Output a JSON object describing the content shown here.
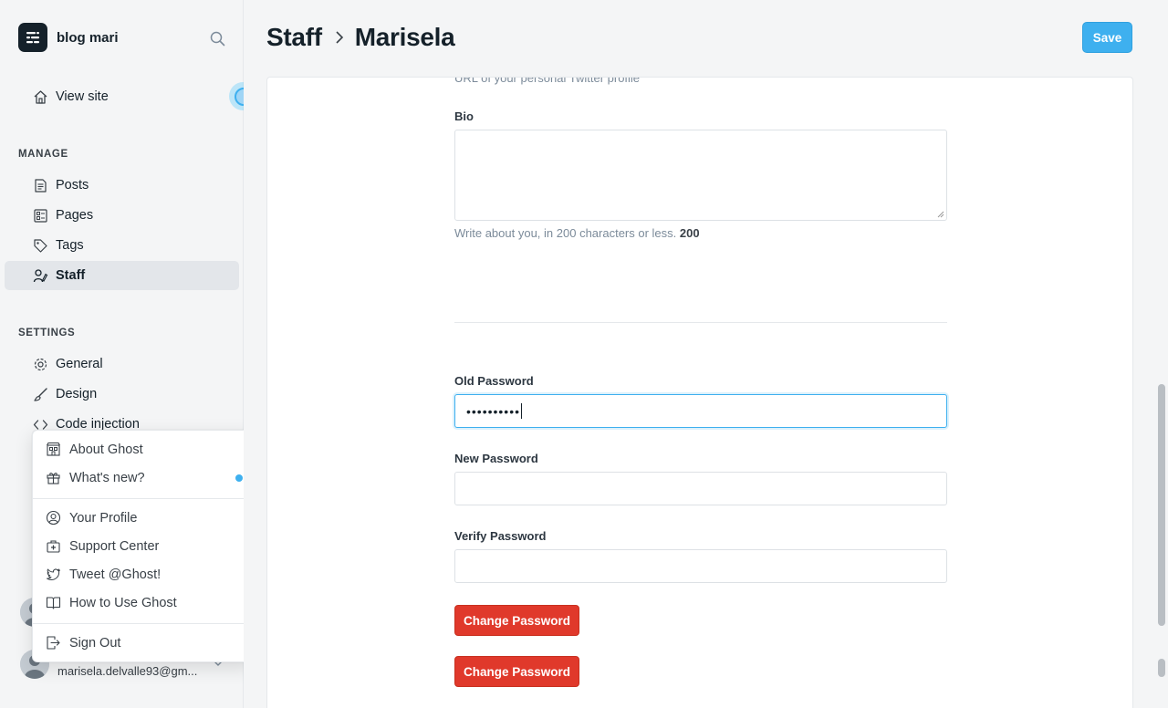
{
  "sidebar": {
    "brand_name": "blog mari",
    "view_site": "View site",
    "manage_label": "MANAGE",
    "settings_label": "SETTINGS",
    "manage_items": [
      {
        "label": "Posts",
        "icon": "posts-icon"
      },
      {
        "label": "Pages",
        "icon": "pages-icon"
      },
      {
        "label": "Tags",
        "icon": "tag-icon"
      },
      {
        "label": "Staff",
        "icon": "staff-icon",
        "active": true
      }
    ],
    "settings_items": [
      {
        "label": "General",
        "icon": "gear-icon"
      },
      {
        "label": "Design",
        "icon": "brush-icon"
      },
      {
        "label": "Code injection",
        "icon": "code-icon"
      }
    ],
    "user_email": "marisela.delvalle93@gm..."
  },
  "user_menu": {
    "items": [
      {
        "label": "About Ghost",
        "icon": "building-icon"
      },
      {
        "label": "What's new?",
        "icon": "gift-icon",
        "has_dot": true
      },
      {
        "label": "Your Profile",
        "icon": "user-circle-icon"
      },
      {
        "label": "Support Center",
        "icon": "support-icon"
      },
      {
        "label": "Tweet @Ghost!",
        "icon": "twitter-icon"
      },
      {
        "label": "How to Use Ghost",
        "icon": "book-icon"
      },
      {
        "label": "Sign Out",
        "icon": "sign-out-icon"
      }
    ]
  },
  "header": {
    "crumb_parent": "Staff",
    "crumb_current": "Marisela",
    "save_label": "Save"
  },
  "form": {
    "twitter_hint": "URL of your personal Twitter profile",
    "bio_label": "Bio",
    "bio_value": "",
    "bio_hint": "Write about you, in 200 characters or less.",
    "bio_count": "200",
    "old_password_label": "Old Password",
    "old_password_value": "••••••••••",
    "new_password_label": "New Password",
    "verify_password_label": "Verify Password",
    "change_password_label": "Change Password",
    "change_password_label_2": "Change Password"
  },
  "colors": {
    "accent": "#3eb0ef",
    "danger": "#e0392b",
    "sidebar_bg": "#f4f5f6"
  }
}
